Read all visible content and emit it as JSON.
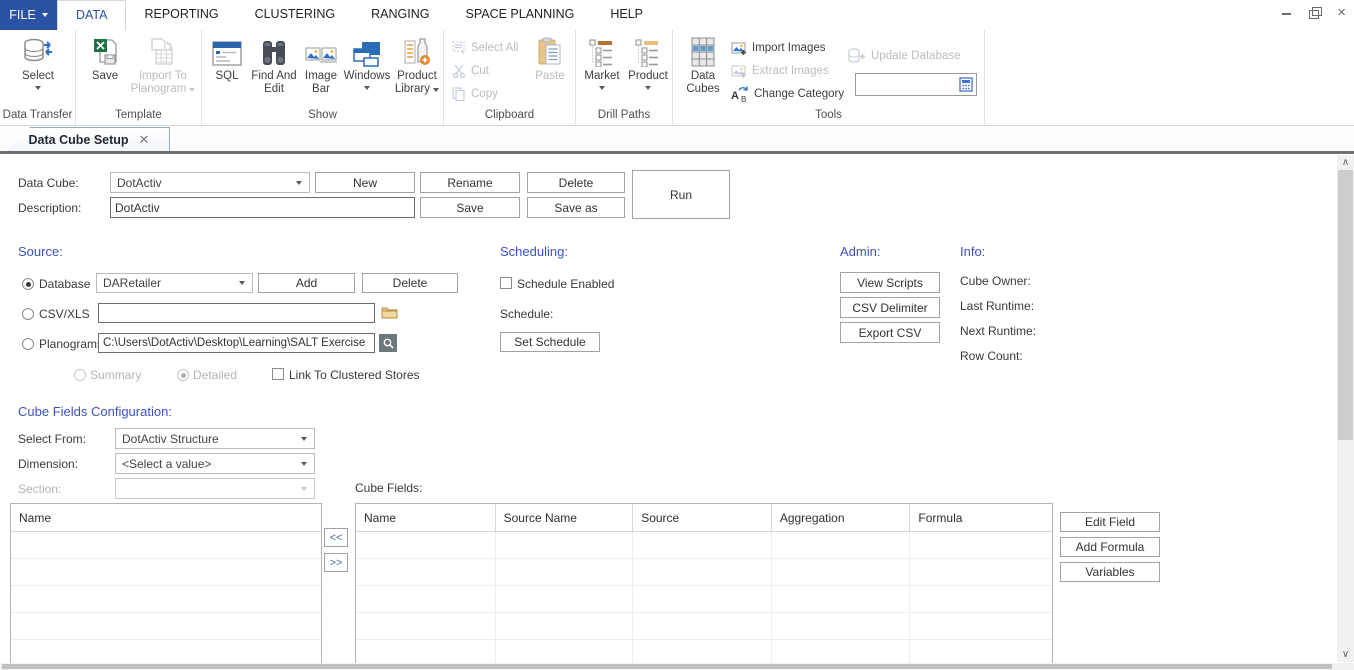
{
  "titlebar": {
    "file_label": "FILE",
    "menu_tabs": [
      "DATA",
      "REPORTING",
      "CLUSTERING",
      "RANGING",
      "SPACE PLANNING",
      "HELP"
    ]
  },
  "ribbon": {
    "data_transfer": {
      "label": "Data Transfer",
      "select": "Select"
    },
    "template": {
      "label": "Template",
      "save": "Save",
      "import_to_planogram": "Import To Planogram"
    },
    "show": {
      "label": "Show",
      "sql": "SQL",
      "find_and_edit": "Find And Edit",
      "image_bar": "Image Bar",
      "windows": "Windows",
      "product_library": "Product Library"
    },
    "clipboard": {
      "label": "Clipboard",
      "select_all": "Select All",
      "cut": "Cut",
      "copy": "Copy",
      "paste": "Paste"
    },
    "drill_paths": {
      "label": "Drill Paths",
      "market": "Market",
      "product": "Product"
    },
    "tools": {
      "label": "Tools",
      "data_cubes": "Data Cubes",
      "import_images": "Import Images",
      "extract_images": "Extract Images",
      "change_category": "Change Category",
      "update_database": "Update Database",
      "search_value": ""
    }
  },
  "doc_tab": {
    "title": "Data Cube Setup"
  },
  "cube_form": {
    "data_cube_label": "Data Cube:",
    "data_cube_value": "DotActiv",
    "description_label": "Description:",
    "description_value": "DotActiv",
    "new": "New",
    "rename": "Rename",
    "delete": "Delete",
    "run": "Run",
    "save": "Save",
    "save_as": "Save as"
  },
  "source": {
    "heading": "Source:",
    "database_label": "Database",
    "database_value": "DARetailer",
    "add": "Add",
    "delete": "Delete",
    "csv_label": "CSV/XLS",
    "csv_value": "",
    "planograms_label": "Planograms",
    "planograms_value": "C:\\Users\\DotActiv\\Desktop\\Learning\\SALT Exercise",
    "summary_label": "Summary",
    "detailed_label": "Detailed",
    "link_label": "Link To Clustered Stores"
  },
  "scheduling": {
    "heading": "Scheduling:",
    "schedule_enabled_label": "Schedule Enabled",
    "schedule_label": "Schedule:",
    "set_schedule": "Set Schedule"
  },
  "admin": {
    "heading": "Admin:",
    "view_scripts": "View Scripts",
    "csv_delimiter": "CSV Delimiter",
    "export_csv": "Export CSV"
  },
  "info": {
    "heading": "Info:",
    "cube_owner": "Cube Owner:",
    "last_runtime": "Last Runtime:",
    "next_runtime": "Next Runtime:",
    "row_count": "Row Count:"
  },
  "cube_fields": {
    "heading": "Cube Fields Configuration:",
    "select_from_label": "Select From:",
    "select_from_value": "DotActiv Structure",
    "dimension_label": "Dimension:",
    "dimension_value": "<Select a value>",
    "section_label": "Section:",
    "section_value": "",
    "left_list_header": "Name",
    "move_left": "<<",
    "move_right": ">>",
    "cube_fields_label": "Cube Fields:",
    "table_headers": [
      "Name",
      "Source Name",
      "Source",
      "Aggregation",
      "Formula"
    ],
    "edit_field": "Edit Field",
    "add_formula": "Add Formula",
    "variables": "Variables"
  },
  "colors": {
    "accent_blue": "#2b52a3",
    "heading_blue": "#3b52c1",
    "cube_icon_blue": "#5b9bd5"
  }
}
